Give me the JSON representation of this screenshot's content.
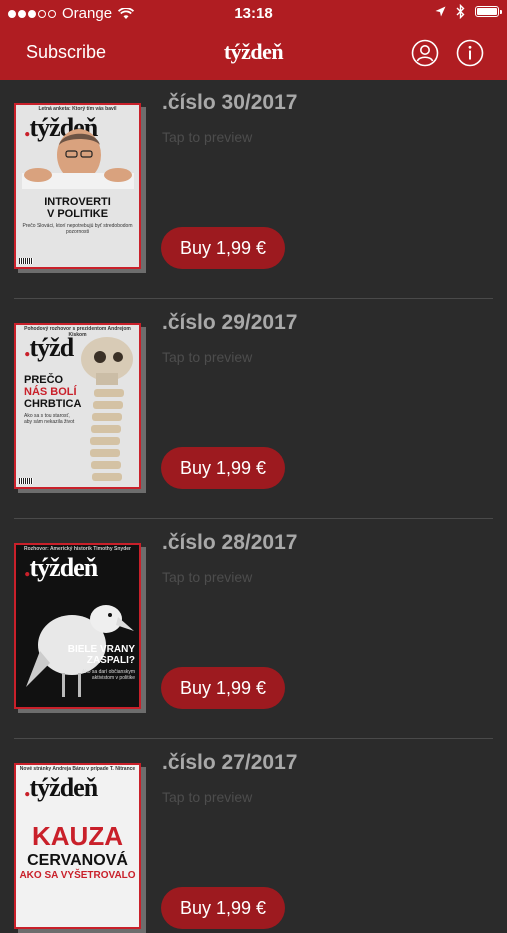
{
  "status": {
    "carrier": "Orange",
    "time": "13:18"
  },
  "nav": {
    "subscribe": "Subscribe",
    "logo": "týždeň",
    "icons": [
      "user-icon",
      "info-icon"
    ]
  },
  "tap_to_preview": "Tap to preview",
  "issues": [
    {
      "title": ".číslo 30/2017",
      "buy": "Buy 1,99 €",
      "cover": {
        "top": "Letná anketa: Ktorý tím vás bavil",
        "mast": ".týždeň",
        "headline_1": "INTROVERTI",
        "headline_2": "V POLITIKE",
        "sub": "Prečo Slováci, ktorí nepotrebujú byť stredobodom pozornosti"
      }
    },
    {
      "title": ".číslo 29/2017",
      "buy": "Buy 1,99 €",
      "cover": {
        "top": "Pohodový rozhovor s prezidentom Andrejom Kiskom",
        "mast": ".týžd",
        "headline_1": "PREČO",
        "headline_2": "NÁS BOLÍ",
        "headline_3": "CHRBTICA",
        "sub": "Ako sa s tou starosť, aby sám nekazila život"
      }
    },
    {
      "title": ".číslo 28/2017",
      "buy": "Buy 1,99 €",
      "cover": {
        "top": "Rozhovor: Americký historik Timothy Snyder",
        "mast": ".týždeň",
        "headline_1": "BIELE VRANY",
        "headline_2": "ZASPALI?",
        "sub": "Ako sa darí občianskym aktivistom v politike"
      }
    },
    {
      "title": ".číslo 27/2017",
      "buy": "Buy 1,99 €",
      "cover": {
        "top": "Nové stránky Andreja Bánu v prípade T. Nitrance",
        "mast": ".týždeň",
        "headline_1": "KAUZA",
        "headline_2": "CERVANOVÁ",
        "headline_3": "AKO SA VYŠETROVALO"
      }
    }
  ],
  "colors": {
    "brand_red": "#b01d22",
    "button_red": "#9d1a1f",
    "background": "#2b2b2b"
  }
}
